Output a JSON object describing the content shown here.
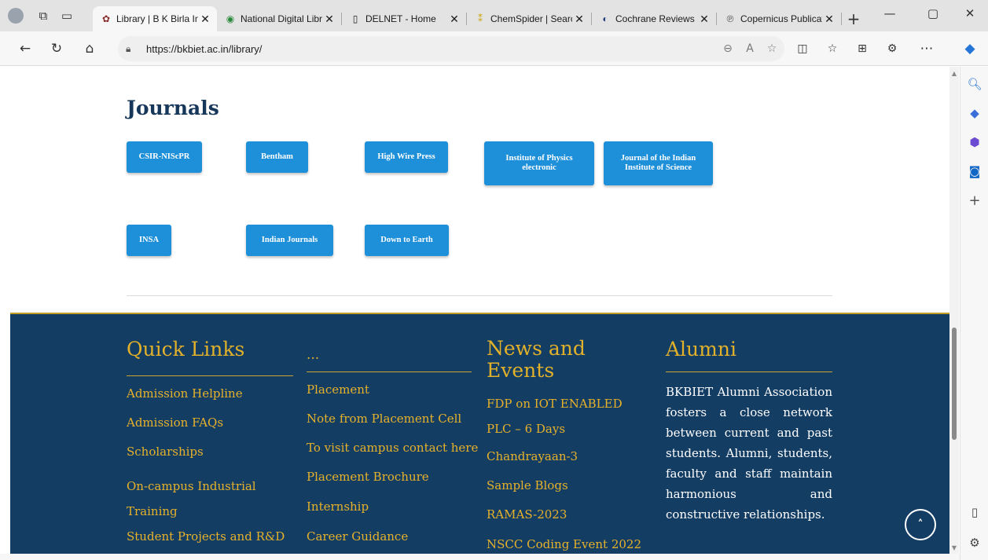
{
  "browser": {
    "tabs": [
      {
        "title": "Library | B K Birla Ins",
        "favicon": "bkbiet-logo-icon",
        "active": true
      },
      {
        "title": "National Digital Libr",
        "favicon": "ndl-logo-icon",
        "active": false
      },
      {
        "title": "DELNET - Home",
        "favicon": "page-icon",
        "active": false
      },
      {
        "title": "ChemSpider | Search",
        "favicon": "chemspider-icon",
        "active": false
      },
      {
        "title": "Cochrane Reviews |",
        "favicon": "cochrane-icon",
        "active": false
      },
      {
        "title": "Copernicus Publicati",
        "favicon": "copernicus-icon",
        "active": false
      }
    ],
    "close_glyph": "✕",
    "new_tab_glyph": "+",
    "url": "https://bkbiet.ac.in/library/"
  },
  "page": {
    "journals_title": "Journals",
    "journals": [
      {
        "label": "CSIR-NIScPR"
      },
      {
        "label": "Bentham"
      },
      {
        "label": "High Wire Press"
      },
      {
        "label": "Institute of Physics electronic"
      },
      {
        "label": "Journal of the Indian Institute of Science"
      },
      {
        "label": "INSA"
      },
      {
        "label": "Indian Journals"
      },
      {
        "label": "Down to Earth"
      }
    ]
  },
  "footer": {
    "quick_links": {
      "heading": "Quick Links",
      "items": [
        "Admission Helpline",
        "Admission FAQs",
        "Scholarships",
        "On-campus Industrial Training",
        "Student Projects and R&D"
      ]
    },
    "placement": {
      "heading": "...",
      "items": [
        "Placement",
        "Note from Placement Cell",
        "To visit campus contact here",
        "Placement Brochure",
        "Internship",
        "Career Guidance"
      ]
    },
    "news": {
      "heading": "News and Events",
      "items": [
        "FDP on IOT ENABLED PLC – 6 Days",
        "Chandrayaan-3",
        "Sample Blogs",
        "RAMAS-2023",
        "NSCC Coding Event 2022"
      ]
    },
    "alumni": {
      "heading": "Alumni",
      "text": "BKBIET Alumni Association fosters a close network between current and past students. Alumni, students, faculty and staff maintain harmonious and constructive relationships."
    },
    "back_to_top": "˄"
  },
  "colors": {
    "footer_bg": "#143d64",
    "gold": "#e6b22a",
    "button_blue": "#1e8fd9",
    "title_navy": "#163759"
  }
}
